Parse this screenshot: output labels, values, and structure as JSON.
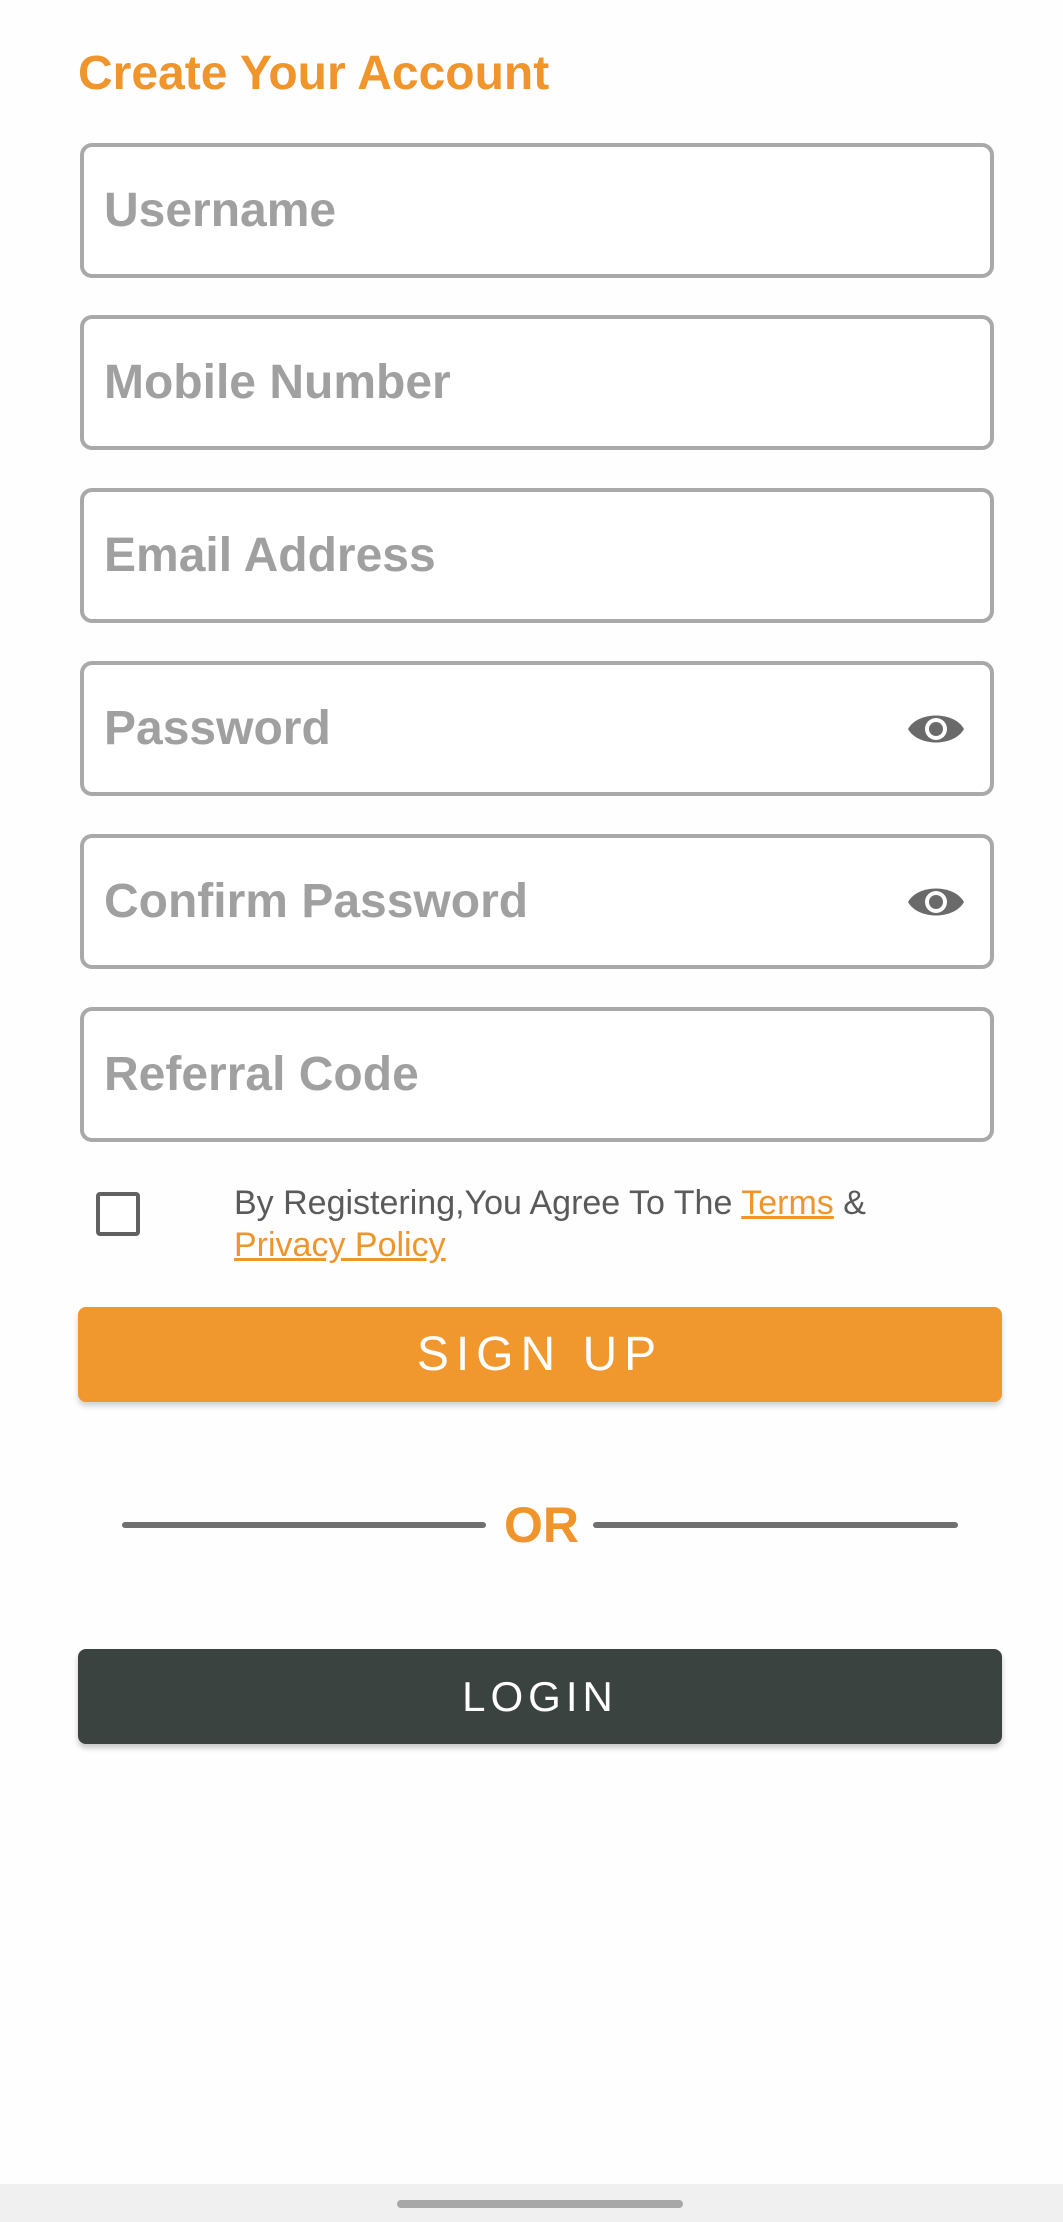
{
  "header": {
    "title": "Create Your Account"
  },
  "form": {
    "username_placeholder": "Username",
    "username_value": "",
    "mobile_placeholder": "Mobile Number",
    "mobile_value": "",
    "email_placeholder": "Email Address",
    "email_value": "",
    "password_placeholder": "Password",
    "password_value": "",
    "confirm_password_placeholder": "Confirm Password",
    "confirm_password_value": "",
    "referral_placeholder": "Referral Code",
    "referral_value": "",
    "password_toggle_icon": "eye-icon",
    "confirm_password_toggle_icon": "eye-icon"
  },
  "agreement": {
    "checked": false,
    "prefix": "By Registering,You Agree To The ",
    "terms_link": "Terms",
    "joiner": " & ",
    "privacy_link": "Privacy Policy"
  },
  "actions": {
    "signup_label": "SIGN UP",
    "divider_label": "OR",
    "login_label": "LOGIN"
  },
  "colors": {
    "accent": "#f0952c",
    "signup_button": "#f0972d",
    "login_button": "#3b4341",
    "field_border": "#a9a9a9",
    "placeholder": "#a0a0a0"
  }
}
